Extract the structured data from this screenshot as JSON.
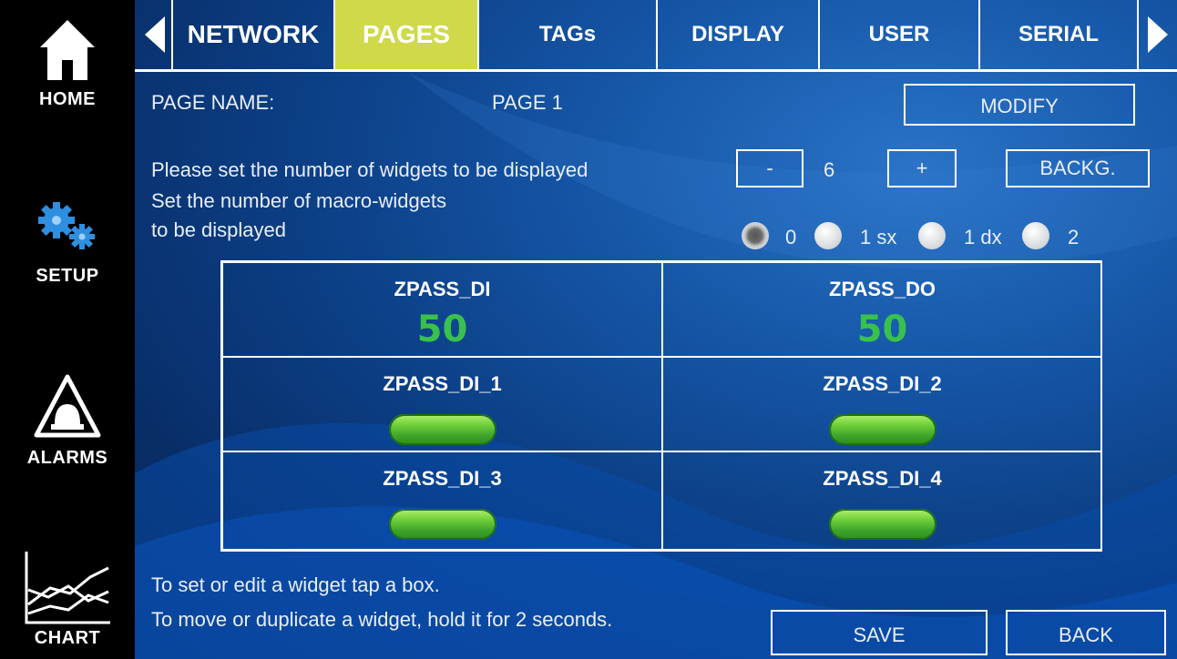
{
  "sidebar": {
    "home": "HOME",
    "setup": "SETUP",
    "alarms": "ALARMS",
    "chart": "CHART"
  },
  "tabs": [
    {
      "label": "NETWORK",
      "active": false
    },
    {
      "label": "PAGES",
      "active": true
    },
    {
      "label": "TAGs",
      "active": false
    },
    {
      "label": "DISPLAY",
      "active": false
    },
    {
      "label": "USER",
      "active": false
    },
    {
      "label": "SERIAL",
      "active": false
    }
  ],
  "page": {
    "name_label": "PAGE NAME:",
    "name_value": "PAGE 1",
    "modify_label": "MODIFY"
  },
  "widgets_count": {
    "text": "Please set the number of widgets to be displayed",
    "minus": "-",
    "value": "6",
    "plus": "+",
    "backg": "BACKG."
  },
  "macro": {
    "line1": "Set the number of macro-widgets",
    "line2": "to be displayed",
    "options": [
      {
        "label": "0",
        "selected": true
      },
      {
        "label": "1 sx",
        "selected": false
      },
      {
        "label": "1 dx",
        "selected": false
      },
      {
        "label": "2",
        "selected": false
      }
    ]
  },
  "grid": [
    {
      "title": "ZPASS_DI",
      "value": "50"
    },
    {
      "title": "ZPASS_DO",
      "value": "50"
    },
    {
      "title": "ZPASS_DI_1",
      "indicator": "green"
    },
    {
      "title": "ZPASS_DI_2",
      "indicator": "green"
    },
    {
      "title": "ZPASS_DI_3",
      "indicator": "green"
    },
    {
      "title": "ZPASS_DI_4",
      "indicator": "green"
    }
  ],
  "footer": {
    "hint1": "To set or edit a widget tap a box.",
    "hint2": "To move or duplicate a widget, hold it for 2 seconds.",
    "save": "SAVE",
    "back": "BACK"
  },
  "colors": {
    "active_tab": "#cfd94a",
    "value_green": "#39c24b",
    "background_blue": "#0c3f86"
  }
}
